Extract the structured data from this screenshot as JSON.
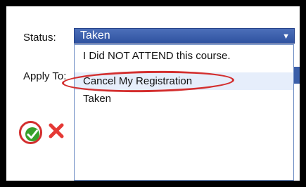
{
  "form": {
    "status_label": "Status:",
    "apply_label": "Apply To:"
  },
  "status_select": {
    "selected": "Taken",
    "options": [
      "I Did NOT ATTEND this course.",
      "Cancel My Registration",
      "Taken"
    ],
    "highlighted_index": 1
  },
  "actions": {
    "confirm_icon": "checkmark-icon",
    "cancel_icon": "cross-icon"
  },
  "colors": {
    "select_bg": "#3a5ea8",
    "annotation": "#d32f2f",
    "confirm": "#37a02b",
    "cancel": "#e53935"
  }
}
